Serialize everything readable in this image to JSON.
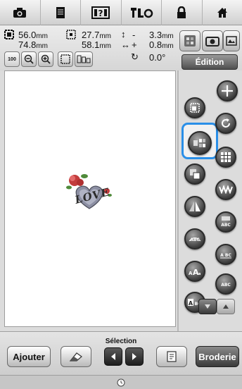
{
  "toolbar": {
    "items": [
      {
        "icon": "camera-icon"
      },
      {
        "icon": "document-icon"
      },
      {
        "icon": "help-icon"
      },
      {
        "icon": "settings-icon"
      },
      {
        "icon": "lock-icon"
      },
      {
        "icon": "home-icon"
      }
    ]
  },
  "info": {
    "width_value": "56.0",
    "height_value": "74.8",
    "pos_x_value": "27.7",
    "pos_y_value": "58.1",
    "unit": "mm",
    "offset_value_1": "3.3",
    "offset_value_2": "0.8",
    "rotation_value": "0.0°",
    "offset_sign_1": "-",
    "offset_sign_2": "+"
  },
  "zoom": {
    "level_label": "100"
  },
  "edit_mode": {
    "label": "Édition"
  },
  "canvas": {
    "design_text": "LOVE",
    "design_icon": "heart-embroidery-icon"
  },
  "palette": {
    "tools": [
      "move-icon",
      "rotate-icon",
      "resize-icon",
      "multi-color-icon",
      "group-icon",
      "density-icon",
      "flip-horizontal-icon",
      "array-icon",
      "text-edit-icon",
      "spacing-icon",
      "curve-text-icon",
      "text-spacing-icon",
      "font-size-icon",
      "text-color-icon",
      "text-font-icon"
    ]
  },
  "bottom": {
    "add_label": "Ajouter",
    "selection_label": "Sélection",
    "embroider_label": "Broderie"
  },
  "colors": {
    "accent": "#2a8fe8",
    "button_dark": "#3a3a3a"
  }
}
